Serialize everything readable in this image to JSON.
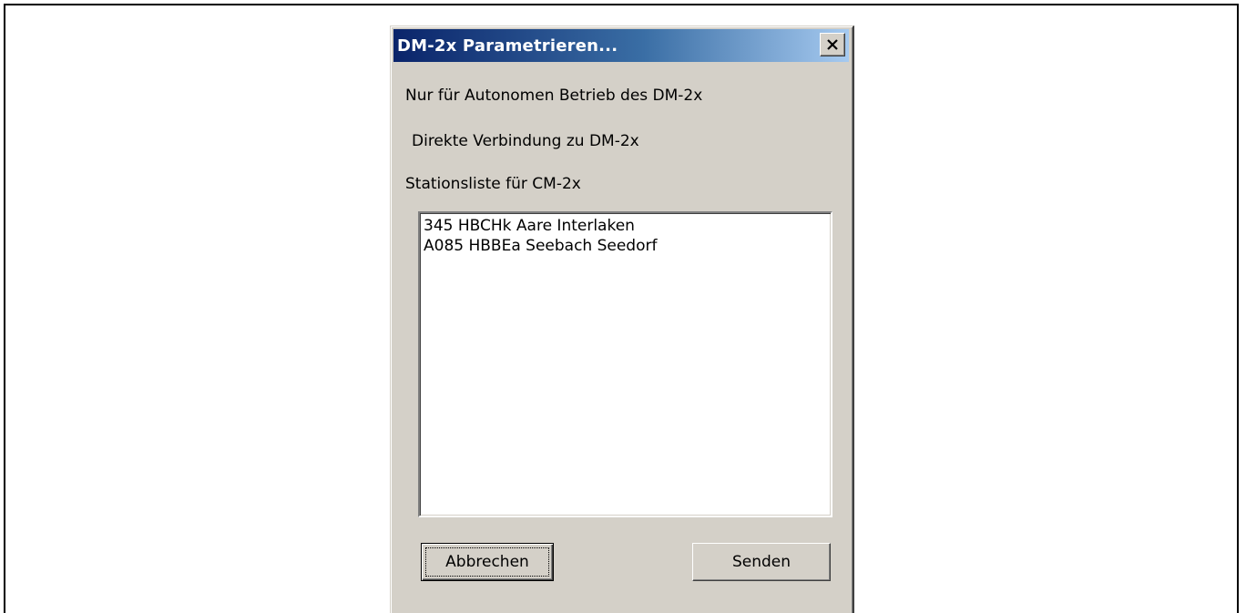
{
  "dialog": {
    "title": "DM-2x Parametrieren...",
    "close_icon": "close-icon",
    "info_line1": "Nur für Autonomen Betrieb des DM-2x",
    "info_line2": "Direkte Verbindung zu DM-2x",
    "list_label": "Stationsliste für CM-2x",
    "stations": [
      "345 HBCHk Aare Interlaken",
      "A085 HBBEa Seebach Seedorf"
    ],
    "buttons": {
      "cancel_label": "Abbrechen",
      "send_label": "Senden"
    }
  },
  "colors": {
    "dialog_bg": "#d4d0c8",
    "titlebar_start": "#0a246a",
    "titlebar_end": "#a6caf0"
  }
}
